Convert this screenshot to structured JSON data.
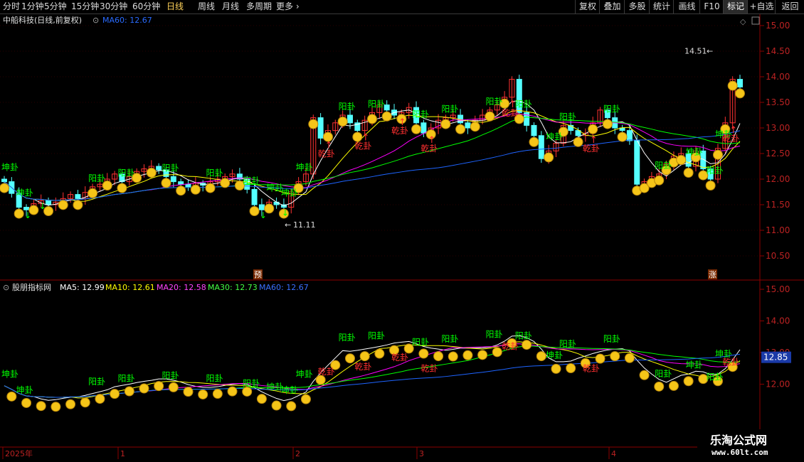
{
  "toolbar": {
    "periods": [
      "分时",
      "1分钟",
      "5分钟",
      "15分钟",
      "30分钟",
      "60分钟",
      "日线",
      "周线",
      "月线",
      "多周期",
      "更多"
    ],
    "active_period": "日线",
    "right_buttons": [
      "复权",
      "叠加",
      "多股",
      "统计",
      "画线",
      "F10",
      "标记",
      "+自选",
      "返回"
    ],
    "active_right": "标记"
  },
  "main_panel": {
    "title": "中船科技(日线,前复权)",
    "ma_label": "MA60: 12.67",
    "high_label": "14.51",
    "low_label": "11.11",
    "marker_yu": "预",
    "marker_zhang": "涨",
    "y_ticks": [
      "15.00",
      "14.50",
      "14.00",
      "13.50",
      "13.00",
      "12.50",
      "12.00",
      "11.50",
      "11.00",
      "10.50"
    ]
  },
  "sub_panel": {
    "name": "股朋指标网",
    "ma5": "MA5: 12.99",
    "ma10": "MA10: 12.61",
    "ma20": "MA20: 12.58",
    "ma30": "MA30: 12.73",
    "ma60": "MA60: 12.67",
    "y_ticks": [
      "15.00",
      "14.00",
      "13.00",
      "12.00"
    ],
    "current_value": "12.85"
  },
  "date_axis": {
    "labels": [
      "2025年",
      "1",
      "2",
      "3",
      "4"
    ]
  },
  "signals": {
    "kun": "坤卦",
    "yang": "阳卦",
    "qian": "乾卦"
  },
  "watermark": {
    "line1": "乐淘公式网",
    "line2": "www.60lt.com"
  },
  "colors": {
    "background": "#000000",
    "up_candle": "#ff3232",
    "down_candle": "#54ffff",
    "ma5": "#ffffff",
    "ma10": "#ffff00",
    "ma20": "#ff00ff",
    "ma30": "#00ff00",
    "ma60": "#1e64ff",
    "signal_green": "#00ff00",
    "signal_red": "#ff3030",
    "smiley": "#f5c518"
  },
  "chart_data": {
    "type": "candlestick",
    "series_close": [
      11.95,
      11.72,
      11.45,
      11.4,
      11.52,
      11.58,
      11.5,
      11.55,
      11.62,
      11.7,
      11.62,
      11.74,
      11.85,
      11.9,
      12.0,
      12.1,
      11.95,
      12.05,
      12.15,
      12.2,
      12.25,
      12.18,
      12.05,
      11.95,
      11.9,
      11.85,
      11.92,
      11.88,
      11.95,
      12.0,
      12.05,
      12.1,
      12.0,
      11.8,
      11.5,
      11.4,
      11.55,
      11.5,
      11.45,
      11.75,
      11.95,
      12.1,
      13.2,
      12.8,
      12.95,
      13.1,
      13.25,
      13.1,
      12.95,
      13.15,
      13.3,
      13.45,
      13.35,
      13.25,
      13.3,
      13.4,
      13.1,
      12.9,
      13.0,
      13.15,
      13.2,
      13.25,
      13.1,
      13.0,
      13.15,
      13.25,
      13.35,
      13.45,
      13.6,
      13.95,
      13.3,
      13.05,
      12.85,
      12.4,
      12.55,
      12.7,
      13.05,
      12.95,
      12.85,
      12.9,
      13.1,
      13.35,
      13.2,
      13.0,
      12.95,
      12.75,
      11.9,
      11.95,
      12.05,
      12.1,
      12.3,
      12.45,
      12.5,
      12.25,
      12.55,
      12.2,
      12.0,
      12.6,
      13.1,
      13.95,
      13.8
    ]
  }
}
